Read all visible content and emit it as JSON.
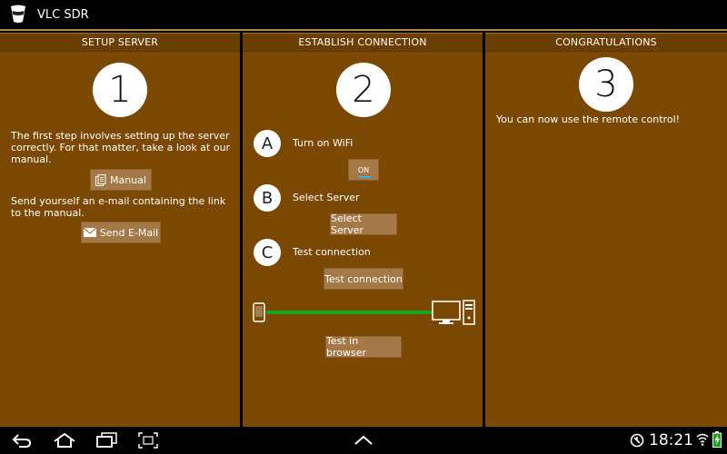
{
  "app": {
    "title": "VLC SDR",
    "icon": "traffic-cone-icon"
  },
  "panels": {
    "setup": {
      "header": "SETUP SERVER",
      "step": "1",
      "text1": "The first step involves setting up the server correctly. For that matter, take a look at our manual.",
      "manual_label": "Manual",
      "text2": "Send yourself an e-mail containing the link to the manual.",
      "email_label": "Send E-Mail"
    },
    "connect": {
      "header": "ESTABLISH CONNECTION",
      "step": "2",
      "a_letter": "A",
      "a_label": "Turn on WiFi",
      "wifi_toggle": "ON",
      "b_letter": "B",
      "b_label": "Select Server",
      "select_server_label": "Select Server",
      "c_letter": "C",
      "c_label": "Test connection",
      "test_connection_label": "Test connection",
      "test_browser_label": "Test in browser"
    },
    "done": {
      "header": "CONGRATULATIONS",
      "step": "3",
      "text": "You can now use the remote control!"
    }
  },
  "status": {
    "clock": "18:21"
  },
  "colors": {
    "panel": "#7a4800",
    "header": "#6a3e00",
    "button": "#a47847",
    "connection": "#1aa51a",
    "accent": "#33b5e5"
  }
}
